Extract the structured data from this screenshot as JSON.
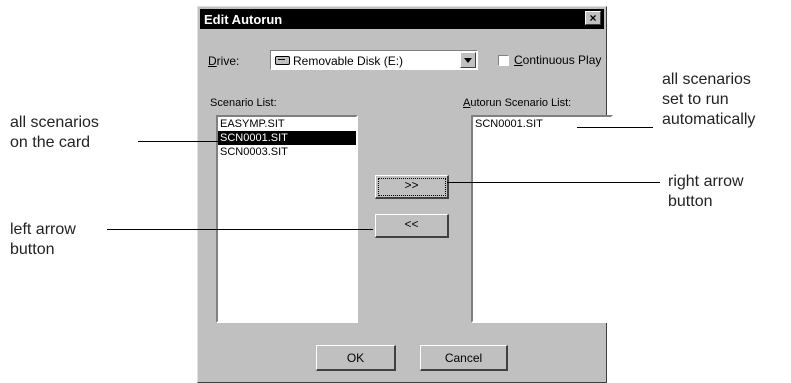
{
  "dialog": {
    "title": "Edit Autorun",
    "close_label": "×",
    "drive_label": "Drive:",
    "drive_value": "Removable Disk (E:)",
    "continuous_play_label": "Continuous Play",
    "scenario_list_label": "Scenario List:",
    "autorun_list_label": "Autorun Scenario List:",
    "scenario_items": [
      "EASYMP.SIT",
      "SCN0001.SIT",
      "SCN0003.SIT"
    ],
    "autorun_items": [
      "SCN0001.SIT"
    ],
    "add_button_label": ">>",
    "remove_button_label": "<<",
    "ok_label": "OK",
    "cancel_label": "Cancel"
  },
  "annotations": {
    "scenarios_card": [
      "all scenarios",
      "on the card"
    ],
    "left_arrow": [
      "left arrow",
      "button"
    ],
    "autorun_set": [
      "all scenarios",
      "set to run",
      "automatically"
    ],
    "right_arrow": [
      "right arrow",
      "button"
    ]
  },
  "icons": {
    "drive": "removable-disk-icon",
    "dropdown": "chevron-down-icon",
    "close": "close-icon"
  }
}
